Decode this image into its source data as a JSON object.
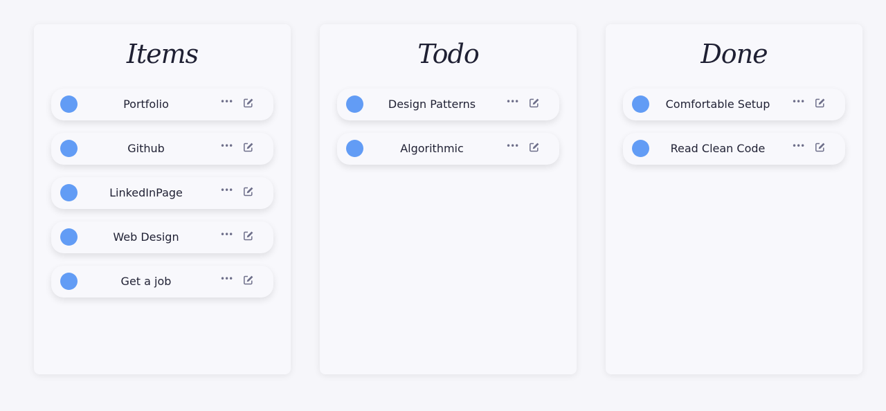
{
  "colors": {
    "background": "#f6f6fa",
    "card": "#f8f8fc",
    "dot": "#629cf5",
    "text": "#1f2033",
    "icon": "#6e6f8a"
  },
  "columns": [
    {
      "title": "Items",
      "items": [
        {
          "label": "Portfolio",
          "more_icon": "ellipsis-icon",
          "edit_icon": "edit-icon"
        },
        {
          "label": "Github",
          "more_icon": "ellipsis-icon",
          "edit_icon": "edit-icon"
        },
        {
          "label": "LinkedInPage",
          "more_icon": "ellipsis-icon",
          "edit_icon": "edit-icon"
        },
        {
          "label": "Web Design",
          "more_icon": "ellipsis-icon",
          "edit_icon": "edit-icon"
        },
        {
          "label": "Get a job",
          "more_icon": "ellipsis-icon",
          "edit_icon": "edit-icon"
        }
      ]
    },
    {
      "title": "Todo",
      "items": [
        {
          "label": "Design Patterns",
          "more_icon": "ellipsis-icon",
          "edit_icon": "edit-icon"
        },
        {
          "label": "Algorithmic",
          "more_icon": "ellipsis-icon",
          "edit_icon": "edit-icon"
        }
      ]
    },
    {
      "title": "Done",
      "items": [
        {
          "label": "Comfortable Setup",
          "more_icon": "ellipsis-icon",
          "edit_icon": "edit-icon"
        },
        {
          "label": "Read Clean Code",
          "more_icon": "ellipsis-icon",
          "edit_icon": "edit-icon"
        }
      ]
    }
  ],
  "more_glyph": "•••"
}
